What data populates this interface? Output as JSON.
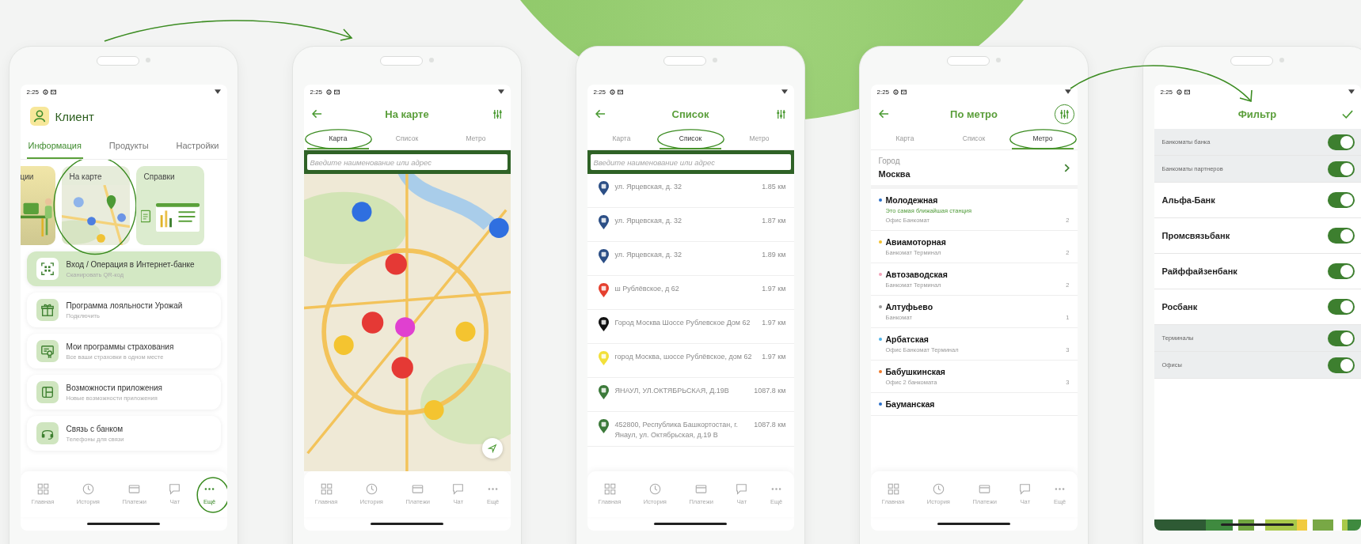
{
  "screens": [
    {
      "kind": "home",
      "time": "2:25",
      "profile": {
        "name": "Клиент"
      },
      "tabs": [
        {
          "label": "Информация",
          "selected": true
        },
        {
          "label": "Продукты",
          "selected": false
        },
        {
          "label": "Настройки",
          "selected": false
        }
      ],
      "cards": [
        {
          "title": "ции",
          "kind": "illustration",
          "annotated": false
        },
        {
          "title": "На карте",
          "kind": "map",
          "annotated": true
        },
        {
          "title": "Справки",
          "kind": "documents",
          "annotated": false
        }
      ],
      "menu": [
        {
          "title": "Вход / Операция в Интернет-банке",
          "subtitle": "Сканировать QR-код",
          "selected": true
        },
        {
          "title": "Программа лояльности Урожай",
          "subtitle": "Подключить",
          "selected": false
        },
        {
          "title": "Мои программы страхования",
          "subtitle": "Все ваши страховки в одном месте",
          "selected": false
        },
        {
          "title": "Возможности приложения",
          "subtitle": "Новые возможности приложения",
          "selected": false
        },
        {
          "title": "Связь с банком",
          "subtitle": "Телефоны для связи",
          "selected": false
        }
      ],
      "nav": [
        {
          "label": "Главная",
          "selected": false,
          "annotated": false
        },
        {
          "label": "История",
          "selected": false,
          "annotated": false
        },
        {
          "label": "Платежи",
          "selected": false,
          "annotated": false
        },
        {
          "label": "Чат",
          "selected": false,
          "annotated": false
        },
        {
          "label": "Ещё",
          "selected": true,
          "annotated": true
        }
      ]
    },
    {
      "kind": "map",
      "time": "2:25",
      "header": {
        "title": "На карте",
        "filter_annotated": false
      },
      "tabs": [
        {
          "label": "Карта",
          "selected": true,
          "annotated": true
        },
        {
          "label": "Список",
          "selected": false,
          "annotated": false
        },
        {
          "label": "Метро",
          "selected": false,
          "annotated": false
        }
      ],
      "search": {
        "placeholder": "Введите наименование или адрес"
      },
      "nav": [
        {
          "label": "Главная",
          "selected": false
        },
        {
          "label": "История",
          "selected": false
        },
        {
          "label": "Платежи",
          "selected": false
        },
        {
          "label": "Чат",
          "selected": false
        },
        {
          "label": "Ещё",
          "selected": false
        }
      ]
    },
    {
      "kind": "list",
      "time": "2:25",
      "header": {
        "title": "Список",
        "filter_annotated": false
      },
      "tabs": [
        {
          "label": "Карта",
          "selected": false,
          "annotated": false
        },
        {
          "label": "Список",
          "selected": true,
          "annotated": true
        },
        {
          "label": "Метро",
          "selected": false,
          "annotated": false
        }
      ],
      "search": {
        "placeholder": "Введите наименование или адрес"
      },
      "places": [
        {
          "address": "ул. Ярцевская, д. 32",
          "distance": "1.85 км",
          "color": "#2c4f86"
        },
        {
          "address": "ул. Ярцевская, д. 32",
          "distance": "1.87 км",
          "color": "#2c4f86"
        },
        {
          "address": "ул. Ярцевская, д. 32",
          "distance": "1.89 км",
          "color": "#2c4f86"
        },
        {
          "address": "ш Рублёвское, д 62",
          "distance": "1.97 км",
          "color": "#e5402f"
        },
        {
          "address": "Город Москва Шоссе Рублевское Дом 62",
          "distance": "1.97 км",
          "color": "#111111"
        },
        {
          "address": "город Москва, шоссе Рублёвское, дом 62",
          "distance": "1.97 км",
          "color": "#f2e03a"
        },
        {
          "address": "ЯНАУЛ, УЛ.ОКТЯБРЬСКАЯ, Д.19В",
          "distance": "1087.8 км",
          "color": "#3c7a3a"
        },
        {
          "address": "452800, Республика Башкортостан, г. Янаул, ул. Октябрьская, д.19 В",
          "distance": "1087.8 км",
          "color": "#3c7a3a"
        }
      ],
      "nav": [
        {
          "label": "Главная",
          "selected": false
        },
        {
          "label": "История",
          "selected": false
        },
        {
          "label": "Платежи",
          "selected": false
        },
        {
          "label": "Чат",
          "selected": false
        },
        {
          "label": "Ещё",
          "selected": false
        }
      ]
    },
    {
      "kind": "metro",
      "time": "2:25",
      "header": {
        "title": "По метро",
        "filter_annotated": true
      },
      "tabs": [
        {
          "label": "Карта",
          "selected": false,
          "annotated": false
        },
        {
          "label": "Список",
          "selected": false,
          "annotated": false
        },
        {
          "label": "Метро",
          "selected": true,
          "annotated": true
        }
      ],
      "city": {
        "label": "Город",
        "value": "Москва"
      },
      "stations": [
        {
          "name": "Молодежная",
          "color": "#2a6fc9",
          "note": "Это самая ближайшая станция",
          "services": "Офис Банкомат",
          "count": "2"
        },
        {
          "name": "Авиамоторная",
          "color": "#f2c12e",
          "services": "Банкомат Терминал",
          "count": "2"
        },
        {
          "name": "Автозаводская",
          "color": "#f3a3bb",
          "services": "Банкомат Терминал",
          "count": "2"
        },
        {
          "name": "Алтуфьево",
          "color": "#9a9a9a",
          "services": "Банкомат",
          "count": "1"
        },
        {
          "name": "Арбатская",
          "color": "#4fb3e8",
          "services": "Офис Банкомат Терминал",
          "count": "3"
        },
        {
          "name": "Бабушкинская",
          "color": "#f07a2a",
          "services": "Офис 2 банкомата",
          "count": "3"
        },
        {
          "name": "Бауманская",
          "color": "#2a6fc9"
        }
      ],
      "nav": [
        {
          "label": "Главная",
          "selected": false
        },
        {
          "label": "История",
          "selected": false
        },
        {
          "label": "Платежи",
          "selected": false
        },
        {
          "label": "Чат",
          "selected": false
        },
        {
          "label": "Ещё",
          "selected": false
        }
      ]
    },
    {
      "kind": "filter",
      "time": "2:25",
      "header": {
        "title": "Фильтр"
      },
      "filters": [
        {
          "label": "Банкоматы банка",
          "kind": "group",
          "on": true
        },
        {
          "label": "Банкоматы партнеров",
          "kind": "group",
          "on": true
        },
        {
          "label": "Альфа-Банк",
          "kind": "bank",
          "on": true
        },
        {
          "label": "Промсвязьбанк",
          "kind": "bank",
          "on": true
        },
        {
          "label": "Райффайзенбанк",
          "kind": "bank",
          "on": true
        },
        {
          "label": "Росбанк",
          "kind": "bank",
          "on": true
        },
        {
          "label": "Терминалы",
          "kind": "group",
          "on": true
        },
        {
          "label": "Офисы",
          "kind": "group",
          "on": true
        }
      ]
    }
  ]
}
